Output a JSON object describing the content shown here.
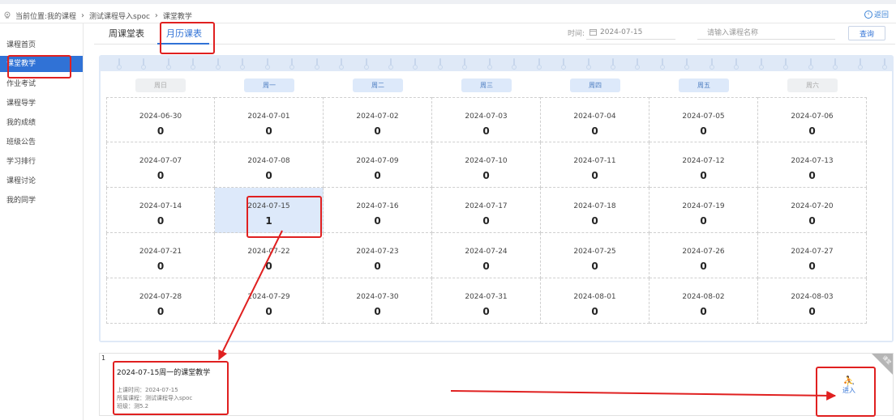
{
  "breadcrumb": {
    "location_label": "当前位置:我的课程",
    "course": "测试课程导入spoc",
    "page": "课堂教学"
  },
  "back_label": "返回",
  "sidebar": {
    "items": [
      {
        "label": "课程首页",
        "active": false
      },
      {
        "label": "课堂教学",
        "active": true
      },
      {
        "label": "作业考试",
        "active": false
      },
      {
        "label": "课程导学",
        "active": false
      },
      {
        "label": "我的成绩",
        "active": false
      },
      {
        "label": "班级公告",
        "active": false
      },
      {
        "label": "学习排行",
        "active": false
      },
      {
        "label": "课程讨论",
        "active": false
      },
      {
        "label": "我的同学",
        "active": false
      }
    ]
  },
  "tabs": [
    {
      "label": "周课堂表",
      "active": false
    },
    {
      "label": "月历课表",
      "active": true
    }
  ],
  "filter": {
    "time_label": "时间:",
    "date_value": "2024-07-15",
    "search_placeholder": "请输入课程名称",
    "search_button": "查询"
  },
  "calendar": {
    "weekdays": [
      "周日",
      "周一",
      "周二",
      "周三",
      "周四",
      "周五",
      "周六"
    ],
    "weeks": [
      [
        {
          "date": "2024-06-30",
          "count": "0"
        },
        {
          "date": "2024-07-01",
          "count": "0"
        },
        {
          "date": "2024-07-02",
          "count": "0"
        },
        {
          "date": "2024-07-03",
          "count": "0"
        },
        {
          "date": "2024-07-04",
          "count": "0"
        },
        {
          "date": "2024-07-05",
          "count": "0"
        },
        {
          "date": "2024-07-06",
          "count": "0"
        }
      ],
      [
        {
          "date": "2024-07-07",
          "count": "0"
        },
        {
          "date": "2024-07-08",
          "count": "0"
        },
        {
          "date": "2024-07-09",
          "count": "0"
        },
        {
          "date": "2024-07-10",
          "count": "0"
        },
        {
          "date": "2024-07-11",
          "count": "0"
        },
        {
          "date": "2024-07-12",
          "count": "0"
        },
        {
          "date": "2024-07-13",
          "count": "0"
        }
      ],
      [
        {
          "date": "2024-07-14",
          "count": "0"
        },
        {
          "date": "2024-07-15",
          "count": "1",
          "today": true
        },
        {
          "date": "2024-07-16",
          "count": "0"
        },
        {
          "date": "2024-07-17",
          "count": "0"
        },
        {
          "date": "2024-07-18",
          "count": "0"
        },
        {
          "date": "2024-07-19",
          "count": "0"
        },
        {
          "date": "2024-07-20",
          "count": "0"
        }
      ],
      [
        {
          "date": "2024-07-21",
          "count": "0"
        },
        {
          "date": "2024-07-22",
          "count": "0"
        },
        {
          "date": "2024-07-23",
          "count": "0"
        },
        {
          "date": "2024-07-24",
          "count": "0"
        },
        {
          "date": "2024-07-25",
          "count": "0"
        },
        {
          "date": "2024-07-26",
          "count": "0"
        },
        {
          "date": "2024-07-27",
          "count": "0"
        }
      ],
      [
        {
          "date": "2024-07-28",
          "count": "0"
        },
        {
          "date": "2024-07-29",
          "count": "0"
        },
        {
          "date": "2024-07-30",
          "count": "0"
        },
        {
          "date": "2024-07-31",
          "count": "0"
        },
        {
          "date": "2024-08-01",
          "count": "0"
        },
        {
          "date": "2024-08-02",
          "count": "0"
        },
        {
          "date": "2024-08-03",
          "count": "0"
        }
      ]
    ]
  },
  "detail": {
    "count": "1",
    "title": "2024-07-15周一的课堂教学",
    "time_line": "上课时间：2024-07-15",
    "course_line": "所属课程：测试课程导入spoc",
    "class_line": "班级：测5.2",
    "corner_label": "课堂",
    "enter_label": "进入"
  },
  "colors": {
    "accent": "#3072d6",
    "annotation": "#e02020"
  }
}
